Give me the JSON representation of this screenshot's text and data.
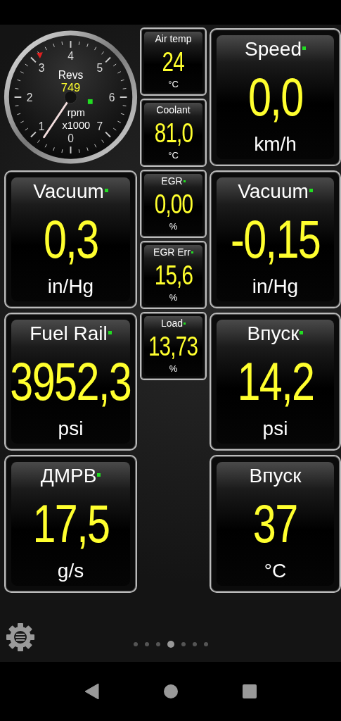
{
  "gauge": {
    "title": "Revs",
    "reading": "749",
    "unit": "rpm",
    "scale": "x1000",
    "indicator": true,
    "ticks": [
      "0",
      "1",
      "2",
      "3",
      "4",
      "5",
      "6",
      "7"
    ]
  },
  "columns": [
    {
      "kind": "left",
      "tiles": [
        {
          "kind": "gauge"
        },
        {
          "kind": "large",
          "label": "Vacuum",
          "value": "0,3",
          "unit": "in/Hg",
          "indicator": true
        },
        {
          "kind": "large",
          "label": "Fuel Rail",
          "value": "3952,3",
          "unit": "psi",
          "indicator": true
        },
        {
          "kind": "large",
          "label": "ДМРВ",
          "value": "17,5",
          "unit": "g/s",
          "indicator": true
        }
      ]
    },
    {
      "kind": "middle",
      "tiles": [
        {
          "kind": "small",
          "label": "Air temp",
          "value": "24",
          "unit": "°C",
          "indicator": false
        },
        {
          "kind": "small",
          "label": "Coolant",
          "value": "81,0",
          "unit": "°C",
          "indicator": false
        },
        {
          "kind": "small",
          "label": "EGR",
          "value": "0,00",
          "unit": "%",
          "indicator": true
        },
        {
          "kind": "small",
          "label": "EGR Err",
          "value": "15,6",
          "unit": "%",
          "indicator": true
        },
        {
          "kind": "small",
          "label": "Load",
          "value": "13,73",
          "unit": "%",
          "indicator": true
        }
      ]
    },
    {
      "kind": "right",
      "tiles": [
        {
          "kind": "large",
          "label": "Speed",
          "value": "0,0",
          "unit": "km/h",
          "indicator": true
        },
        {
          "kind": "large",
          "label": "Vacuum",
          "value": "-0,15",
          "unit": "in/Hg",
          "indicator": true
        },
        {
          "kind": "large",
          "label": "Впуск",
          "value": "14,2",
          "unit": "psi",
          "indicator": true
        },
        {
          "kind": "large",
          "label": "Впуск",
          "value": "37",
          "unit": "°C",
          "indicator": false
        }
      ]
    }
  ],
  "pages": [
    {
      "selected": false
    },
    {
      "selected": false
    },
    {
      "selected": false
    },
    {
      "selected": true
    },
    {
      "selected": false
    },
    {
      "selected": false
    },
    {
      "selected": false
    }
  ]
}
